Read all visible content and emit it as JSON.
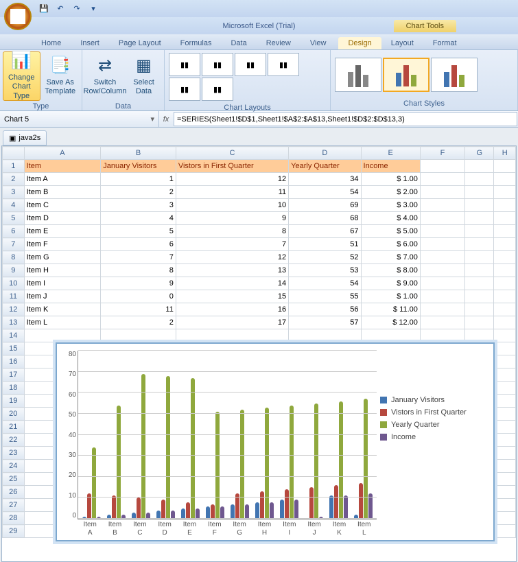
{
  "app_title": "Microsoft Excel (Trial)",
  "chart_tools": "Chart Tools",
  "tabs": [
    "Home",
    "Insert",
    "Page Layout",
    "Formulas",
    "Data",
    "Review",
    "View"
  ],
  "ctx_tabs": [
    "Design",
    "Layout",
    "Format"
  ],
  "ribbon": {
    "type_group": "Type",
    "data_group": "Data",
    "layouts_group": "Chart Layouts",
    "styles_group": "Chart Styles",
    "change_chart_type": "Change Chart Type",
    "save_as_template": "Save As Template",
    "switch_rowcol": "Switch Row/Column",
    "select_data": "Select Data"
  },
  "name_box": "Chart 5",
  "formula": "=SERIES(Sheet1!$D$1,Sheet1!$A$2:$A$13,Sheet1!$D$2:$D$13,3)",
  "doc_tab": "java2s",
  "columns": [
    "A",
    "B",
    "C",
    "D",
    "E",
    "F",
    "G",
    "H"
  ],
  "headers": {
    "A": "Item",
    "B": "January Visitors",
    "C": "Vistors in First Quarter",
    "D": "Yearly Quarter",
    "E": "Income"
  },
  "rows": [
    {
      "r": 1
    },
    {
      "r": 2,
      "A": "Item A",
      "B": "1",
      "C": "12",
      "D": "34",
      "E": "$         1.00"
    },
    {
      "r": 3,
      "A": "Item B",
      "B": "2",
      "C": "11",
      "D": "54",
      "E": "$         2.00"
    },
    {
      "r": 4,
      "A": "Item C",
      "B": "3",
      "C": "10",
      "D": "69",
      "E": "$         3.00"
    },
    {
      "r": 5,
      "A": "Item D",
      "B": "4",
      "C": "9",
      "D": "68",
      "E": "$         4.00"
    },
    {
      "r": 6,
      "A": "Item E",
      "B": "5",
      "C": "8",
      "D": "67",
      "E": "$         5.00"
    },
    {
      "r": 7,
      "A": "Item F",
      "B": "6",
      "C": "7",
      "D": "51",
      "E": "$         6.00"
    },
    {
      "r": 8,
      "A": "Item G",
      "B": "7",
      "C": "12",
      "D": "52",
      "E": "$         7.00"
    },
    {
      "r": 9,
      "A": "Item H",
      "B": "8",
      "C": "13",
      "D": "53",
      "E": "$         8.00"
    },
    {
      "r": 10,
      "A": "Item I",
      "B": "9",
      "C": "14",
      "D": "54",
      "E": "$         9.00"
    },
    {
      "r": 11,
      "A": "Item J",
      "B": "0",
      "C": "15",
      "D": "55",
      "E": "$         1.00"
    },
    {
      "r": 12,
      "A": "Item K",
      "B": "11",
      "C": "16",
      "D": "56",
      "E": "$       11.00"
    },
    {
      "r": 13,
      "A": "Item L",
      "B": "2",
      "C": "17",
      "D": "57",
      "E": "$       12.00"
    },
    {
      "r": 14
    },
    {
      "r": 15
    },
    {
      "r": 16
    },
    {
      "r": 17
    },
    {
      "r": 18
    },
    {
      "r": 19
    },
    {
      "r": 20
    },
    {
      "r": 21
    },
    {
      "r": 22
    },
    {
      "r": 23
    },
    {
      "r": 24
    },
    {
      "r": 25
    },
    {
      "r": 26
    },
    {
      "r": 27
    },
    {
      "r": 28
    },
    {
      "r": 29
    }
  ],
  "chart_data": {
    "type": "bar",
    "categories": [
      "Item A",
      "Item B",
      "Item C",
      "Item D",
      "Item E",
      "Item F",
      "Item G",
      "Item H",
      "Item I",
      "Item J",
      "Item K",
      "Item L"
    ],
    "series": [
      {
        "name": "January Visitors",
        "color": "#4275b1",
        "values": [
          1,
          2,
          3,
          4,
          5,
          6,
          7,
          8,
          9,
          0,
          11,
          2
        ]
      },
      {
        "name": "Vistors in First Quarter",
        "color": "#b6483e",
        "values": [
          12,
          11,
          10,
          9,
          8,
          7,
          12,
          13,
          14,
          15,
          16,
          17
        ]
      },
      {
        "name": "Yearly Quarter",
        "color": "#8fa83d",
        "values": [
          34,
          54,
          69,
          68,
          67,
          51,
          52,
          53,
          54,
          55,
          56,
          57
        ]
      },
      {
        "name": "Income",
        "color": "#6f588f",
        "values": [
          1,
          2,
          3,
          4,
          5,
          6,
          7,
          8,
          9,
          1,
          11,
          12
        ]
      }
    ],
    "ylim": [
      0,
      80
    ],
    "yticks": [
      0,
      10,
      20,
      30,
      40,
      50,
      60,
      70,
      80
    ]
  }
}
